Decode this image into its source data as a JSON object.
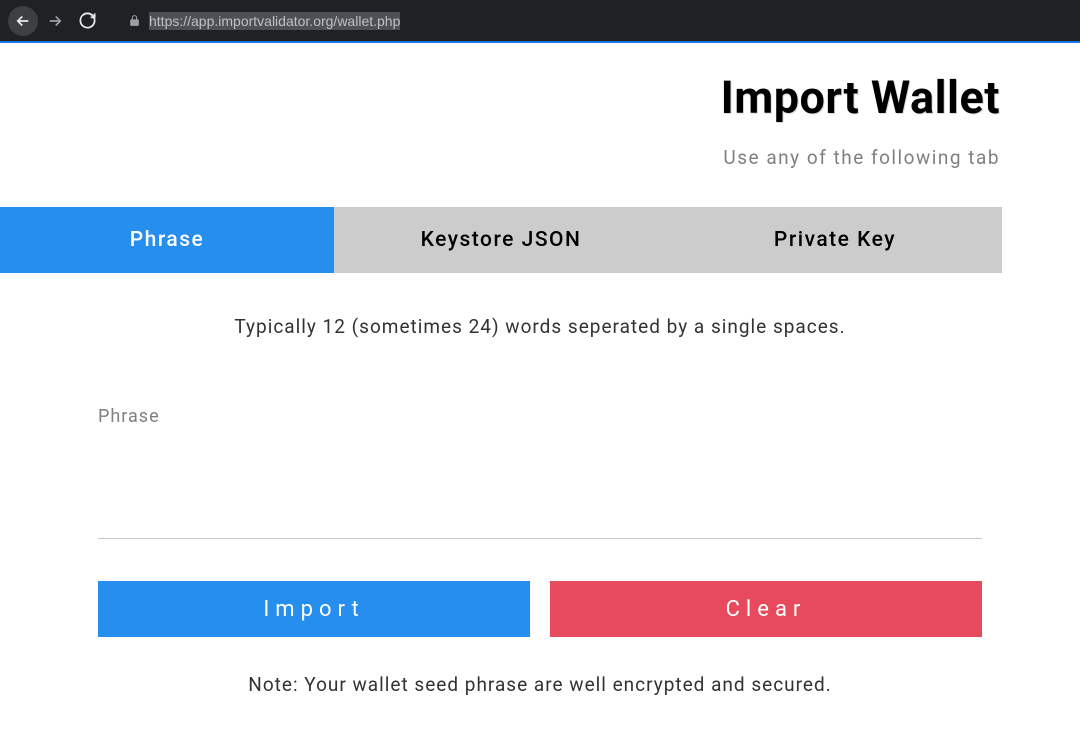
{
  "browser": {
    "url": "https://app.importvalidator.org/wallet.php"
  },
  "header": {
    "title": "Import Wallet",
    "subtitle": "Use any of the following tab"
  },
  "tabs": [
    {
      "label": "Phrase",
      "active": true
    },
    {
      "label": "Keystore JSON",
      "active": false
    },
    {
      "label": "Private Key",
      "active": false
    }
  ],
  "main": {
    "instruction": "Typically 12 (sometimes 24) words seperated by a single spaces.",
    "placeholder": "Phrase",
    "value": ""
  },
  "buttons": {
    "import_label": "Import",
    "clear_label": "Clear"
  },
  "footer": {
    "note": "Note: Your wallet seed phrase are well encrypted and secured."
  }
}
